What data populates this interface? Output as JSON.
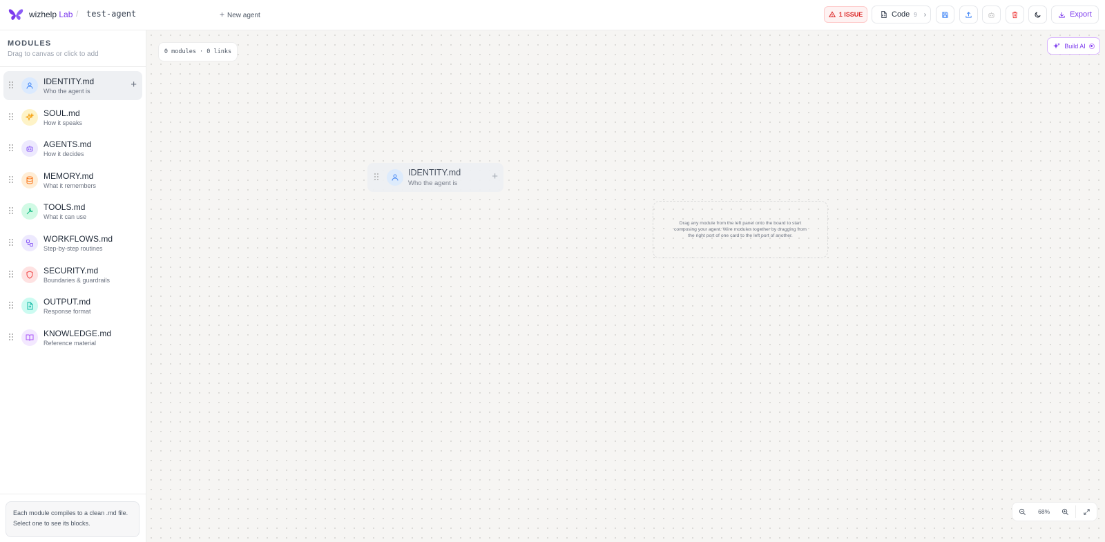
{
  "header": {
    "brand": "wizhelp",
    "brand_suffix": "Lab",
    "separator": "/",
    "agent_name": "test-agent",
    "new_agent_label": "New agent",
    "issue_label": "1 ISSUE",
    "code_label": "Code",
    "code_count": "9",
    "export_label": "Export"
  },
  "sidebar": {
    "title": "MODULES",
    "subtitle": "Drag to canvas or click to add",
    "items": [
      {
        "name": "IDENTITY.md",
        "desc": "Who the agent is",
        "icon": "user-icon",
        "color": "#3b82f6",
        "bg": "#dbeafe"
      },
      {
        "name": "SOUL.md",
        "desc": "How it speaks",
        "icon": "sparkles-icon",
        "color": "#f59e0b",
        "bg": "#fef3c7"
      },
      {
        "name": "AGENTS.md",
        "desc": "How it decides",
        "icon": "bot-icon",
        "color": "#8b5cf6",
        "bg": "#ede9fe"
      },
      {
        "name": "MEMORY.md",
        "desc": "What it remembers",
        "icon": "database-icon",
        "color": "#f97316",
        "bg": "#ffedd5"
      },
      {
        "name": "TOOLS.md",
        "desc": "What it can use",
        "icon": "wrench-icon",
        "color": "#10b981",
        "bg": "#d1fae5"
      },
      {
        "name": "WORKFLOWS.md",
        "desc": "Step-by-step routines",
        "icon": "workflow-icon",
        "color": "#8b5cf6",
        "bg": "#ede9fe"
      },
      {
        "name": "SECURITY.md",
        "desc": "Boundaries & guardrails",
        "icon": "shield-icon",
        "color": "#ef4444",
        "bg": "#fee2e2"
      },
      {
        "name": "OUTPUT.md",
        "desc": "Response format",
        "icon": "file-output-icon",
        "color": "#14b8a6",
        "bg": "#ccfbf1"
      },
      {
        "name": "KNOWLEDGE.md",
        "desc": "Reference material",
        "icon": "book-icon",
        "color": "#a855f7",
        "bg": "#f3e8ff"
      }
    ],
    "help_text": "Each module compiles to a clean .md file. Select one to see its blocks."
  },
  "canvas": {
    "stats": "0 modules · 0 links",
    "build_ai_label": "Build AI",
    "ghost_card": {
      "name": "IDENTITY.md",
      "desc": "Who the agent is"
    },
    "drop_hint": "Drag any module from the left panel onto the board to start composing your agent. Wire modules together by dragging from the right port of one card to the left port of another.",
    "zoom": "68%"
  },
  "colors": {
    "accent": "#7c3aed",
    "issue": "#dc2626"
  }
}
